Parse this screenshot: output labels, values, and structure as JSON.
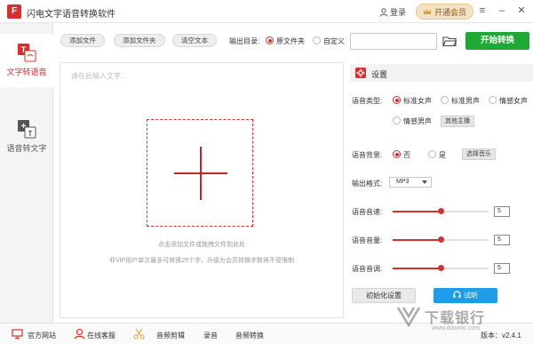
{
  "app": {
    "title": "闪电文字语音转换软件",
    "logo_text": "F",
    "login_label": "登录",
    "vip_label": "开通会员",
    "brand_color": "#d9302f"
  },
  "sidebar": {
    "items": [
      {
        "label": "文字转语音",
        "icon": "text-to-speech-icon",
        "active": true
      },
      {
        "label": "语音转文字",
        "icon": "speech-to-text-icon",
        "active": false
      }
    ]
  },
  "toolbar": {
    "add_file": "添加文件",
    "add_folder": "添加文件夹",
    "clear_text": "清空文本",
    "output_dir_label": "输出目录:",
    "output_options": [
      "原文件夹",
      "自定义"
    ],
    "output_selected": "原文件夹",
    "path_value": "",
    "start_label": "开始转换",
    "start_color": "#1ea935"
  },
  "editor": {
    "placeholder": "请在此输入文字...",
    "hint_line1": "点击添加文件或拖拽文件到此处",
    "hint_line2": "非VIP用户单次最多可转换25个字，升级为会员转换字数将不受限制"
  },
  "settings": {
    "title": "设置",
    "voice_type_label": "语音类型:",
    "voice_options": [
      "标准女声",
      "标准男声",
      "情感女声",
      "情感男声"
    ],
    "voice_selected": "标准女声",
    "more_voices_label": "其他主播",
    "background_label": "语音背景:",
    "background_options": [
      "否",
      "是"
    ],
    "background_selected": "否",
    "choose_music_label": "选择音乐",
    "format_label": "输出格式:",
    "format_value": "MP3",
    "speed_label": "语音音速:",
    "speed_value": "5",
    "speed_level": 0.5,
    "volume_label": "语音音量:",
    "volume_value": "5",
    "volume_level": 0.5,
    "pitch_label": "语音音调:",
    "pitch_value": "5",
    "pitch_level": 0.5,
    "reset_label": "初始化设置",
    "listen_label": "试听",
    "listen_color": "#1e9be9"
  },
  "bottom": {
    "website": "官方网站",
    "service": "在线客服",
    "audio_edit": "音频剪辑",
    "record": "录音",
    "audio_convert": "音频转换",
    "version": "版本：v2.4.1"
  },
  "watermark": {
    "text": "下载银行",
    "url": "www.downkr.com"
  }
}
